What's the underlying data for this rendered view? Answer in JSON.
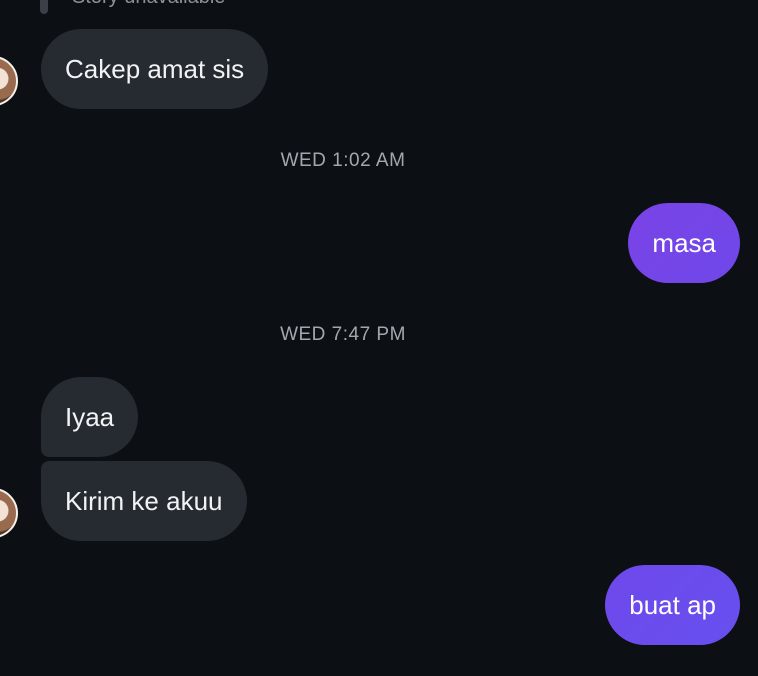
{
  "story": {
    "text": "Story unavailable"
  },
  "messages": [
    {
      "text": "Cakep amat sis"
    },
    {
      "timestamp": "WED 1:02 AM"
    },
    {
      "text": "masa"
    },
    {
      "timestamp": "WED 7:47 PM"
    },
    {
      "text": "Iyaa"
    },
    {
      "text": "Kirim ke akuu"
    },
    {
      "text": "buat ap"
    }
  ],
  "colors": {
    "background": "#0c0f14",
    "incoming_bubble": "#262a31",
    "outgoing_gradient_start": "#7a43e6",
    "outgoing_gradient_end": "#6a4ef0",
    "timestamp_text": "#a3a7b0"
  },
  "icons": {
    "avatar": "user-avatar-photo"
  }
}
